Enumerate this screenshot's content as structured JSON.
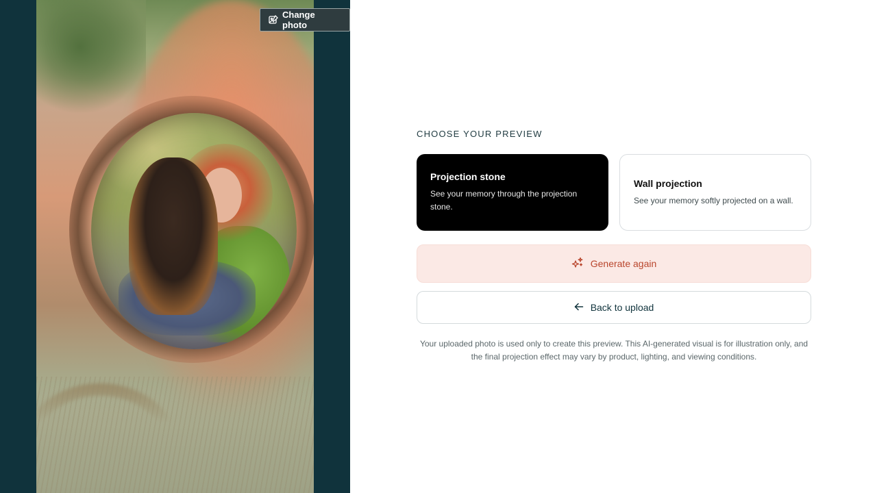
{
  "preview": {
    "change_photo_label": "Change photo",
    "change_photo_icon": "image-edit-icon"
  },
  "options": {
    "heading": "CHOOSE YOUR PREVIEW",
    "cards": [
      {
        "title": "Projection stone",
        "description": "See your memory through the projection stone.",
        "selected": true
      },
      {
        "title": "Wall projection",
        "description": "See your memory softly projected on a wall.",
        "selected": false
      }
    ],
    "generate_label": "Generate again",
    "generate_icon": "sparkles-icon",
    "back_label": "Back to upload",
    "back_icon": "arrow-left-icon",
    "disclaimer": "Your uploaded photo is used only to create this preview. This AI-generated visual is for illustration only, and the final projection effect may vary by product, lighting, and viewing conditions."
  },
  "colors": {
    "panel_background": "#10333c",
    "selected_card": "#000000",
    "generate_background": "#fbe9e5",
    "generate_text": "#b9452c",
    "heading_text": "#1f3a40"
  }
}
